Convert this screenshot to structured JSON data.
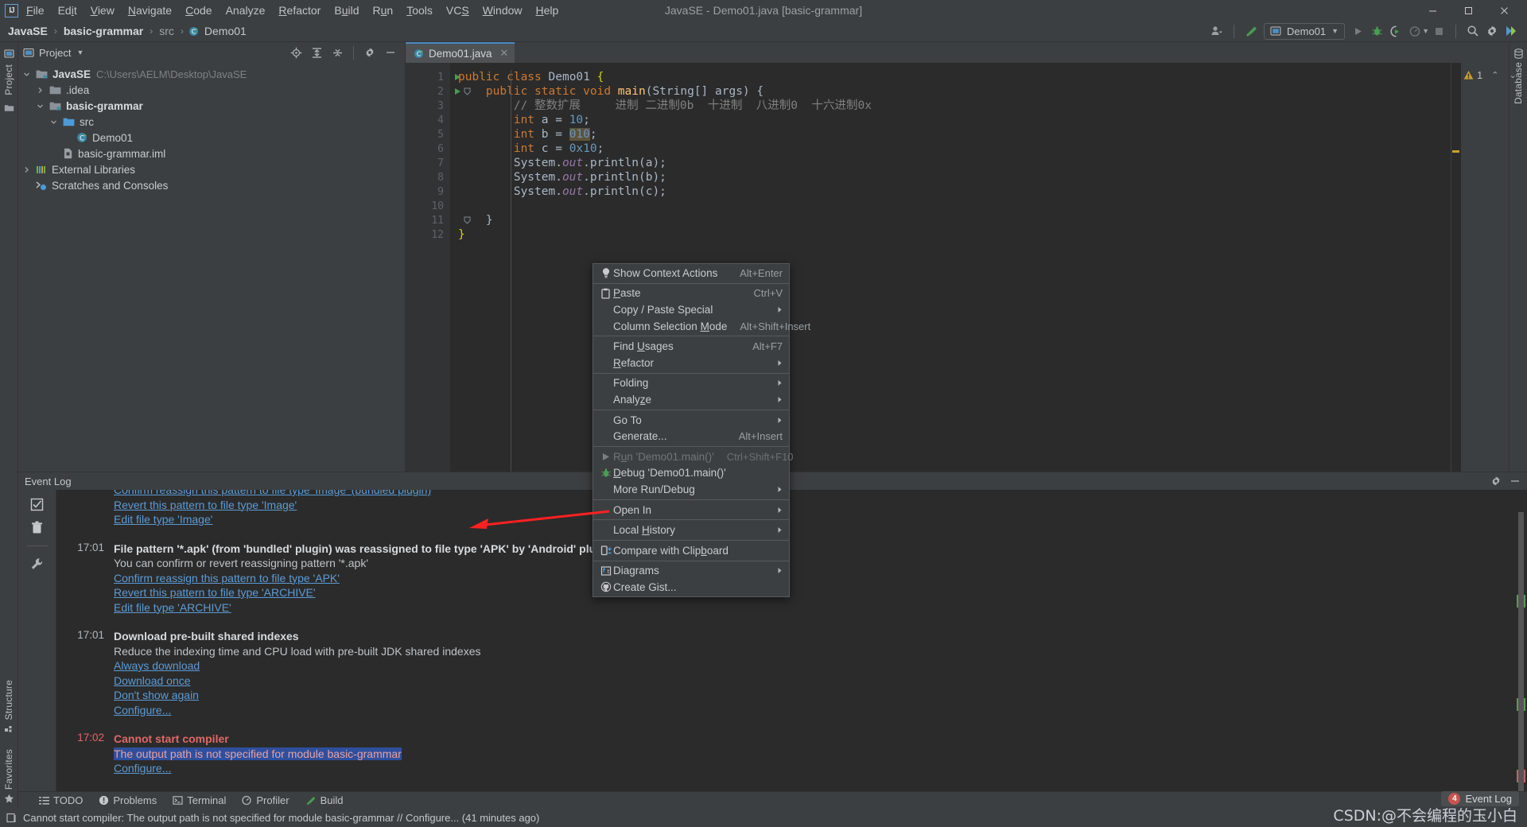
{
  "window": {
    "title": "JavaSE - Demo01.java [basic-grammar]",
    "logo": "intellij-idea-logo",
    "minimize": "–",
    "maximize": "☐",
    "close": "✕"
  },
  "menubar": {
    "items": [
      "File",
      "Edit",
      "View",
      "Navigate",
      "Code",
      "Analyze",
      "Refactor",
      "Build",
      "Run",
      "Tools",
      "VCS",
      "Window",
      "Help"
    ]
  },
  "breadcrumb": {
    "items": [
      {
        "label": "JavaSE",
        "style": "bold"
      },
      {
        "label": "basic-grammar",
        "style": "bold"
      },
      {
        "label": "src",
        "style": "dim"
      },
      {
        "label": "Demo01",
        "style": "normal",
        "icon": "java-class-icon"
      }
    ],
    "separator": "›"
  },
  "toolbar": {
    "user_icon": "user-account-icon",
    "build_icon": "build-hammer-icon",
    "run_config": {
      "label": "Demo01",
      "icon": "run-config-icon",
      "dropdown": "▾"
    },
    "run_button": "run-icon",
    "debug_button": "debug-icon",
    "run_with_coverage_button": "run-coverage-icon",
    "profiler_button": "profiler-icon",
    "stop_button": "stop-icon",
    "search_button": "search-everywhere-icon",
    "settings_button": "settings-gear-icon",
    "updates_button": "updates-icon"
  },
  "project_panel": {
    "title": "Project",
    "dropdown": "▾",
    "icons": [
      "locate-icon",
      "expand-all-icon",
      "collapse-all-icon",
      "settings-gear-icon",
      "hide-icon"
    ],
    "tree": [
      {
        "label": "JavaSE",
        "path": "C:\\Users\\AELM\\Desktop\\JavaSE",
        "depth": 0,
        "arrow": "⌄",
        "icon": "module-folder-icon",
        "bold": true
      },
      {
        "label": ".idea",
        "depth": 1,
        "arrow": "›",
        "icon": "folder-icon",
        "bold": false
      },
      {
        "label": "basic-grammar",
        "depth": 1,
        "arrow": "⌄",
        "icon": "module-folder-icon",
        "bold": true
      },
      {
        "label": "src",
        "depth": 2,
        "arrow": "⌄",
        "icon": "source-folder-icon",
        "bold": false
      },
      {
        "label": "Demo01",
        "depth": 3,
        "arrow": "",
        "icon": "java-class-icon",
        "bold": false
      },
      {
        "label": "basic-grammar.iml",
        "depth": 2,
        "arrow": "",
        "icon": "iml-file-icon",
        "bold": false
      },
      {
        "label": "External Libraries",
        "depth": 0,
        "arrow": "›",
        "icon": "libraries-icon",
        "bold": false
      },
      {
        "label": "Scratches and Consoles",
        "depth": 0,
        "arrow": "",
        "icon": "scratches-icon",
        "bold": false
      }
    ]
  },
  "left_rail": {
    "top": [
      "Project"
    ],
    "bottom": [
      "Structure",
      "Favorites"
    ]
  },
  "right_rail": {
    "labels": [
      "Database"
    ]
  },
  "editor": {
    "tab": {
      "label": "Demo01.java",
      "icon": "java-class-icon",
      "close": "✕"
    },
    "warning_count": "1",
    "warning_icon": "warning-triangle-icon",
    "nav_up": "⌃",
    "nav_down": "⌄",
    "lines": [
      {
        "n": "1",
        "run": true,
        "fold": false,
        "tokens": [
          {
            "t": "public ",
            "c": "k"
          },
          {
            "t": "class ",
            "c": "k"
          },
          {
            "t": "Demo01 ",
            "c": "b"
          },
          {
            "t": "{",
            "c": "bm"
          }
        ],
        "indent": 0
      },
      {
        "n": "2",
        "run": true,
        "fold": true,
        "tokens": [
          {
            "t": "    public ",
            "c": "k"
          },
          {
            "t": "static ",
            "c": "k"
          },
          {
            "t": "void ",
            "c": "k"
          },
          {
            "t": "main",
            "c": "f"
          },
          {
            "t": "(String[] args) {",
            "c": "b"
          }
        ],
        "indent": 0
      },
      {
        "n": "3",
        "run": false,
        "fold": false,
        "tokens": [
          {
            "t": "        // 整数扩展     进制 二进制0b  十进制  八进制0  十六进制0x",
            "c": "c"
          }
        ],
        "indent": 0
      },
      {
        "n": "4",
        "run": false,
        "fold": false,
        "tokens": [
          {
            "t": "        int ",
            "c": "k"
          },
          {
            "t": "a = ",
            "c": "b"
          },
          {
            "t": "10",
            "c": "n"
          },
          {
            "t": ";",
            "c": "b"
          }
        ],
        "indent": 0
      },
      {
        "n": "5",
        "run": false,
        "fold": false,
        "tokens": [
          {
            "t": "        int ",
            "c": "k"
          },
          {
            "t": "b = ",
            "c": "b"
          },
          {
            "t": "010",
            "c": "n hl"
          },
          {
            "t": ";",
            "c": "b"
          }
        ],
        "indent": 0
      },
      {
        "n": "6",
        "run": false,
        "fold": false,
        "tokens": [
          {
            "t": "        int ",
            "c": "k"
          },
          {
            "t": "c = ",
            "c": "b"
          },
          {
            "t": "0x10",
            "c": "n"
          },
          {
            "t": ";",
            "c": "b"
          }
        ],
        "indent": 0
      },
      {
        "n": "7",
        "run": false,
        "fold": false,
        "tokens": [
          {
            "t": "        System.",
            "c": "b"
          },
          {
            "t": "out",
            "c": "s"
          },
          {
            "t": ".println(a);",
            "c": "b"
          }
        ],
        "indent": 0
      },
      {
        "n": "8",
        "run": false,
        "fold": false,
        "tokens": [
          {
            "t": "        System.",
            "c": "b"
          },
          {
            "t": "out",
            "c": "s"
          },
          {
            "t": ".println(b);",
            "c": "b"
          }
        ],
        "indent": 0
      },
      {
        "n": "9",
        "run": false,
        "fold": false,
        "tokens": [
          {
            "t": "        System.",
            "c": "b"
          },
          {
            "t": "out",
            "c": "s"
          },
          {
            "t": ".println(c);",
            "c": "b"
          }
        ],
        "indent": 0
      },
      {
        "n": "10",
        "run": false,
        "fold": false,
        "tokens": [
          {
            "t": "",
            "c": "b"
          }
        ],
        "indent": 0
      },
      {
        "n": "11",
        "run": false,
        "fold": true,
        "tokens": [
          {
            "t": "    }",
            "c": "b"
          }
        ],
        "indent": 0
      },
      {
        "n": "12",
        "run": false,
        "fold": false,
        "tokens": [
          {
            "t": "}",
            "c": "bm"
          }
        ],
        "indent": 0
      }
    ]
  },
  "context_menu": {
    "items": [
      {
        "label": "Show Context Actions",
        "mnemonic": "",
        "key": "Alt+Enter",
        "icon": "lightbulb-icon",
        "arrow": false,
        "sep_after": true
      },
      {
        "label": "Paste",
        "mnemonic": "P",
        "key": "Ctrl+V",
        "icon": "clipboard-paste-icon",
        "arrow": false
      },
      {
        "label": "Copy / Paste Special",
        "mnemonic": "",
        "key": "",
        "icon": "",
        "arrow": true
      },
      {
        "label": "Column Selection Mode",
        "mnemonic": "M",
        "key": "Alt+Shift+Insert",
        "icon": "",
        "arrow": false,
        "sep_after": true
      },
      {
        "label": "Find Usages",
        "mnemonic": "U",
        "key": "Alt+F7",
        "icon": "",
        "arrow": false
      },
      {
        "label": "Refactor",
        "mnemonic": "R",
        "key": "",
        "icon": "",
        "arrow": true,
        "sep_after": true
      },
      {
        "label": "Folding",
        "mnemonic": "",
        "key": "",
        "icon": "",
        "arrow": true
      },
      {
        "label": "Analyze",
        "mnemonic": "z",
        "key": "",
        "icon": "",
        "arrow": true,
        "sep_after": true
      },
      {
        "label": "Go To",
        "mnemonic": "",
        "key": "",
        "icon": "",
        "arrow": true
      },
      {
        "label": "Generate...",
        "mnemonic": "",
        "key": "Alt+Insert",
        "icon": "",
        "arrow": false,
        "sep_after": true
      },
      {
        "label": "Run 'Demo01.main()'",
        "mnemonic": "u",
        "key": "Ctrl+Shift+F10",
        "icon": "run-icon",
        "arrow": false,
        "disabled": true
      },
      {
        "label": "Debug 'Demo01.main()'",
        "mnemonic": "D",
        "key": "",
        "icon": "debug-icon",
        "arrow": false
      },
      {
        "label": "More Run/Debug",
        "mnemonic": "",
        "key": "",
        "icon": "",
        "arrow": true,
        "sep_after": true
      },
      {
        "label": "Open In",
        "mnemonic": "",
        "key": "",
        "icon": "",
        "arrow": true,
        "sep_after": true
      },
      {
        "label": "Local History",
        "mnemonic": "H",
        "key": "",
        "icon": "",
        "arrow": true,
        "sep_after": true
      },
      {
        "label": "Compare with Clipboard",
        "mnemonic": "b",
        "key": "",
        "icon": "compare-clipboard-icon",
        "arrow": false,
        "sep_after": true
      },
      {
        "label": "Diagrams",
        "mnemonic": "",
        "key": "",
        "icon": "diagrams-icon",
        "arrow": true
      },
      {
        "label": "Create Gist...",
        "mnemonic": "",
        "key": "",
        "icon": "github-icon",
        "arrow": false
      }
    ]
  },
  "event_log": {
    "title": "Event Log",
    "head_icons": [
      "settings-gear-icon",
      "hide-icon"
    ],
    "tool_icons": [
      "mark-all-read-icon",
      "delete-icon",
      "settings-wrench-icon"
    ],
    "entries": [
      {
        "time": "",
        "lines": [
          {
            "text": "Confirm reassign this pattern to file type 'Image' (bundled plugin)",
            "type": "link",
            "clipped": true
          },
          {
            "text": "Revert this pattern to file type 'Image'",
            "type": "link"
          },
          {
            "text": "Edit file type 'Image'",
            "type": "link"
          }
        ]
      },
      {
        "time": "17:01",
        "lines": [
          {
            "text": "File pattern '*.apk' (from 'bundled' plugin) was reassigned to file type 'APK' by 'Android' plugin",
            "type": "title"
          },
          {
            "text": "You can confirm or revert reassigning pattern '*.apk'",
            "type": "text"
          },
          {
            "text": "Confirm reassign this pattern to file type 'APK'",
            "type": "link"
          },
          {
            "text": "Revert this pattern to file type 'ARCHIVE'",
            "type": "link"
          },
          {
            "text": "Edit file type 'ARCHIVE'",
            "type": "link"
          }
        ]
      },
      {
        "time": "17:01",
        "lines": [
          {
            "text": "Download pre-built shared indexes",
            "type": "title"
          },
          {
            "text": "Reduce the indexing time and CPU load with pre-built JDK shared indexes",
            "type": "text"
          },
          {
            "text": "Always download",
            "type": "link"
          },
          {
            "text": "Download once",
            "type": "link"
          },
          {
            "text": "Don't show again",
            "type": "link"
          },
          {
            "text": "Configure...",
            "type": "link"
          }
        ]
      },
      {
        "time": "17:02",
        "error": true,
        "lines": [
          {
            "text": "Cannot start compiler",
            "type": "title-err"
          },
          {
            "text": "The output path is not specified for module basic-grammar",
            "type": "text-err-selected"
          },
          {
            "text": "Configure...",
            "type": "link"
          }
        ]
      }
    ]
  },
  "bottom_tabs": [
    {
      "label": "TODO",
      "icon": "todo-icon"
    },
    {
      "label": "Problems",
      "icon": "problems-icon"
    },
    {
      "label": "Terminal",
      "icon": "terminal-icon"
    },
    {
      "label": "Profiler",
      "icon": "profiler-icon"
    },
    {
      "label": "Build",
      "icon": "build-hammer-icon"
    }
  ],
  "status_bar": {
    "icon": "status-message-icon",
    "message": "Cannot start compiler: The output path is not specified for module basic-grammar // Configure... (41 minutes ago)",
    "event_log_button": {
      "label": "Event Log",
      "badge": "4"
    }
  },
  "watermark": "CSDN:@不会编程的玉小白",
  "colors": {
    "accent_blue": "#4b6eaf",
    "link_blue": "#5b9bd5",
    "error_red": "#e26767",
    "warning_yellow": "#c9a227",
    "green_run": "#499c54",
    "bg_panel": "#3c3f41",
    "bg_editor": "#2b2b2b",
    "selection_blue": "#2f4f9e"
  }
}
